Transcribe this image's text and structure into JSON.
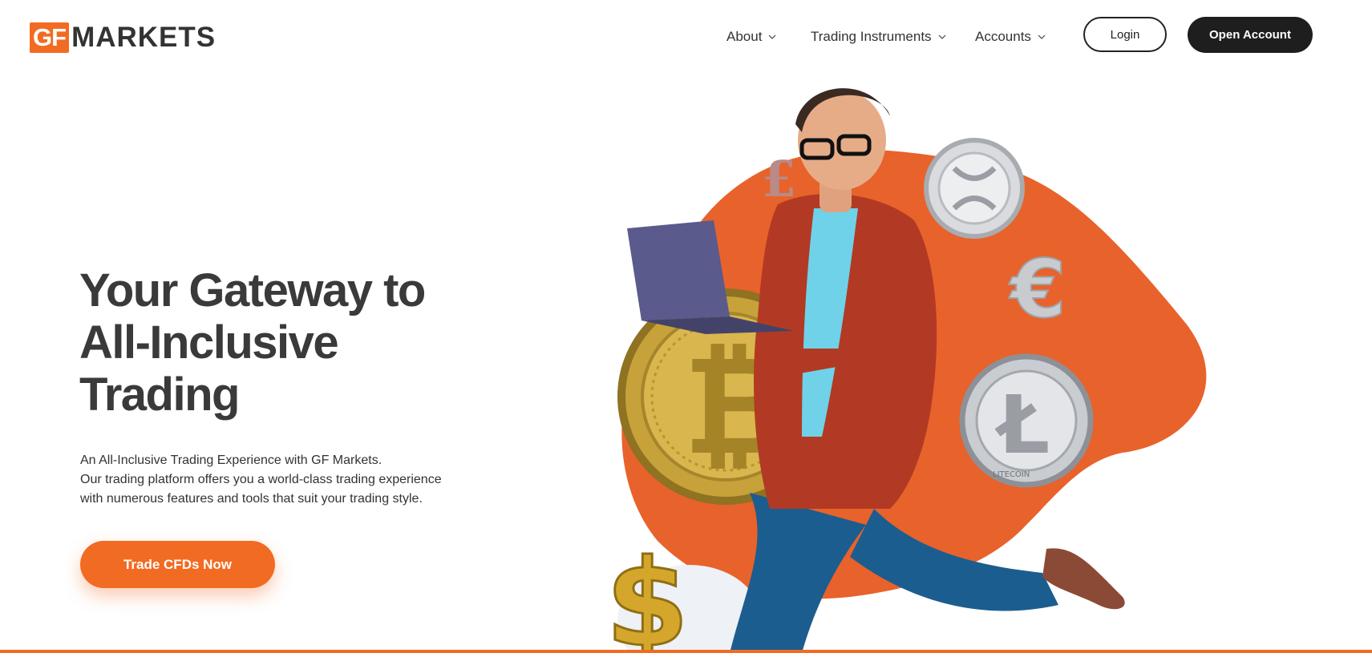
{
  "brand": {
    "logo_gf": "GF",
    "logo_markets": "MARKETS",
    "accent": "#f26b22",
    "dark": "#1e1e1e"
  },
  "nav": {
    "items": [
      {
        "label": "About",
        "icon": "chevron-down-icon"
      },
      {
        "label": "Trading Instruments",
        "icon": "chevron-down-icon"
      },
      {
        "label": "Accounts",
        "icon": "chevron-down-icon"
      }
    ],
    "login_label": "Login",
    "open_account_label": "Open Account"
  },
  "hero": {
    "title_line1": "Your Gateway to",
    "title_line2": "All-Inclusive",
    "title_line3": "Trading",
    "desc_line1": "An All-Inclusive Trading Experience with GF Markets.",
    "desc_line2": "Our trading platform offers you a world-class trading experience",
    "desc_line3": "with numerous features and tools that suit your trading style.",
    "cta_label": "Trade CFDs Now"
  },
  "hero_art": {
    "icons": [
      "pound-symbol-icon",
      "ripple-coin-icon",
      "euro-symbol-icon",
      "bitcoin-coin-icon",
      "litecoin-coin-icon",
      "dollar-symbol-icon",
      "laptop-icon"
    ],
    "coin_labels": {
      "litecoin": "LITECOIN"
    }
  }
}
